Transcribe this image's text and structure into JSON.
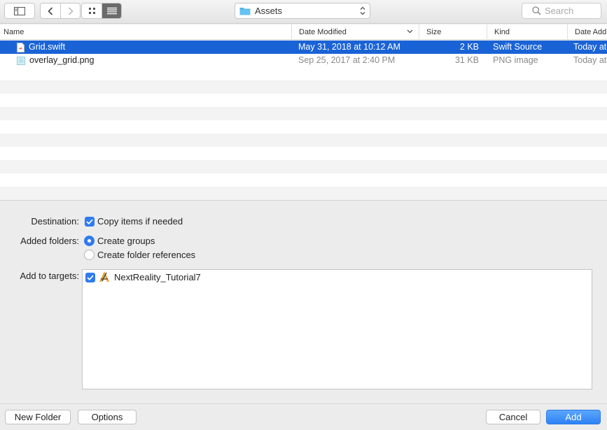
{
  "toolbar": {
    "sidebar_toggle_icon": "sidebar-icon",
    "back_icon": "chevron-left-icon",
    "forward_icon": "chevron-right-icon",
    "icon_view_icon": "grid-icon",
    "list_view_icon": "list-icon",
    "location": "Assets",
    "location_icon": "folder-icon",
    "search_placeholder": "Search"
  },
  "columns": {
    "name": "Name",
    "date_modified": "Date Modified",
    "size": "Size",
    "kind": "Kind",
    "date_added": "Date Add"
  },
  "files": [
    {
      "name": "Grid.swift",
      "date_modified": "May 31, 2018 at 10:12 AM",
      "size": "2 KB",
      "kind": "Swift Source",
      "date_added": "Today at",
      "icon": "swift-file-icon"
    },
    {
      "name": "overlay_grid.png",
      "date_modified": "Sep 25, 2017 at 2:40 PM",
      "size": "31 KB",
      "kind": "PNG image",
      "date_added": "Today at",
      "icon": "png-file-icon"
    }
  ],
  "options": {
    "destination_label": "Destination:",
    "copy_items": "Copy items if needed",
    "added_folders_label": "Added folders:",
    "create_groups": "Create groups",
    "create_folder_refs": "Create folder references",
    "add_to_targets_label": "Add to targets:",
    "target_name": "NextReality_Tutorial7",
    "target_icon": "app-target-icon"
  },
  "footer": {
    "new_folder": "New Folder",
    "options": "Options",
    "cancel": "Cancel",
    "add": "Add"
  },
  "colors": {
    "selection": "#1a63d6",
    "accent": "#2f7bf0"
  }
}
